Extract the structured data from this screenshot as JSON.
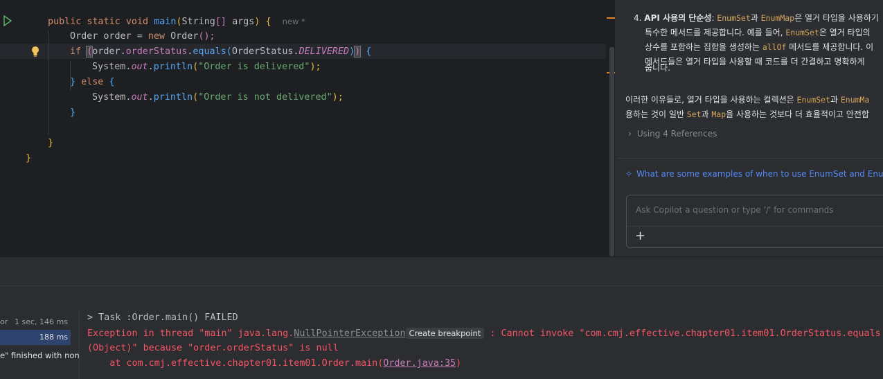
{
  "editor": {
    "main_sig": {
      "public": "public",
      "static": "static",
      "void": "void",
      "main": "main",
      "lp": "(",
      "string": "String",
      "arr": "[]",
      "args": "args",
      "rp": ")",
      "brace": "{",
      "hint": "new *"
    },
    "line2": {
      "type": "Order",
      "var": "order",
      "eq": "=",
      "new": "new",
      "ctor": "Order",
      "tail": "();"
    },
    "line3": {
      "if": "if",
      "lp": "(",
      "obj": "order",
      "dot1": ".",
      "field": "orderStatus",
      "dot2": ".",
      "call": "equals",
      "lp2": "(",
      "enum": "OrderStatus",
      "dot3": ".",
      "cst": "DELIVERED",
      "rp2": ")",
      "rp": ")",
      "brace": "{"
    },
    "line4": {
      "sys": "System",
      "dot": ".",
      "out": "out",
      "dot2": ".",
      "call": "println",
      "lp": "(",
      "str": "\"Order is delivered\"",
      "tail": ");"
    },
    "line5": {
      "close": "}",
      "else": "else",
      "brace": "{"
    },
    "line6": {
      "sys": "System",
      "dot": ".",
      "out": "out",
      "dot2": ".",
      "call": "println",
      "lp": "(",
      "str": "\"Order is not delivered\"",
      "tail": ");"
    },
    "line7": "}",
    "line9": "}",
    "line10": "}"
  },
  "copilot": {
    "item4_num": "4.",
    "item4_title": "API 사용의 단순성",
    "item4_l1a": ": ",
    "item4_code1": "EnumSet",
    "item4_l1b": "과 ",
    "item4_code2": "EnumMap",
    "item4_l1c": "은 열거 타입을 사용하기",
    "item4_l2a": "특수한 메서드를 제공합니다. 예를 들어, ",
    "item4_code3": "EnumSet",
    "item4_l2b": "은 열거 타입의",
    "item4_l3a": "상수를 포함하는 집합을 생성하는 ",
    "item4_code4": "allOf",
    "item4_l3b": " 메서드를 제공합니다. 이",
    "item4_l4": "메서드들은 열거 타입을 사용할 때 코드를 더 간결하고 명확하게",
    "item4_l5": "줍니다.",
    "summary_l1a": "이러한 이유들로, 열거 타입을 사용하는 컬렉션은 ",
    "summary_code1": "EnumSet",
    "summary_l1b": "과 ",
    "summary_code2": "EnumMa",
    "summary_l2a": "용하는 것이 일반 ",
    "summary_code3": "Set",
    "summary_l2b": "과 ",
    "summary_code4": "Map",
    "summary_l2c": "을 사용하는 것보다 더 효율적이고 안전합",
    "references": "Using 4 References",
    "suggestion": "What are some examples of when to use EnumSet and EnumMap",
    "ask_placeholder": "Ask Copilot a question or type '/' for commands"
  },
  "run_tree": {
    "row1_left": "or",
    "row1_time": "1 sec, 146 ms",
    "row2_time": "188 ms",
    "row3_text": "e\" finished with non-"
  },
  "console": {
    "task": "> Task :Order.main() FAILED",
    "exc_a": "Exception in thread \"main\" java.lang.",
    "exc_link": "NullPointerException",
    "create_bp": "Create breakpoint",
    "exc_b": " : Cannot invoke \"com.cmj.effective.chapter01.item01.OrderStatus.equals",
    "exc_c": " (Object)\" because \"order.orderStatus\" is null",
    "at_a": "    at com.cmj.effective.chapter01.item01.Order.main(",
    "at_link": "Order.java:35",
    "at_b": ")"
  }
}
